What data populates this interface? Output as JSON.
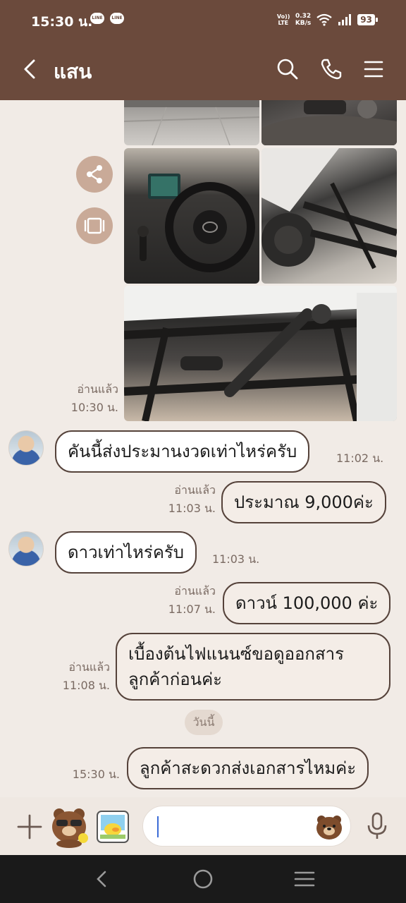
{
  "status_bar": {
    "time": "15:30 น.",
    "notif_badge": "LINE",
    "volte": "Vo)) LTE",
    "net_speed_value": "0.32",
    "net_speed_unit": "KB/s",
    "battery": "93"
  },
  "header": {
    "title": "แสน"
  },
  "photos_meta": {
    "read": "อ่านแล้ว",
    "time": "10:30 น."
  },
  "messages": [
    {
      "side": "other",
      "text": "คันนี้ส่งประมานงวดเท่าไหร่ครับ",
      "time": "11:02 น."
    },
    {
      "side": "mine",
      "read": "อ่านแล้ว",
      "time": "11:03 น.",
      "text": "ประมาณ 9,000ค่ะ"
    },
    {
      "side": "other",
      "text": "ดาวเท่าไหร่ครับ",
      "time": "11:03 น."
    },
    {
      "side": "mine",
      "read": "อ่านแล้ว",
      "time": "11:07 น.",
      "text": "ดาวน์ 100,000 ค่ะ"
    },
    {
      "side": "mine",
      "read": "อ่านแล้ว",
      "time": "11:08 น.",
      "line1": "เบื้องต้นไฟแนนซ์ขอดูออกสาร",
      "line2": "ลูกค้าก่อนค่ะ"
    },
    {
      "side": "mine",
      "time": "15:30 น.",
      "text": "ลูกค้าสะดวกส่งเอกสารไหมค่ะ"
    }
  ],
  "date_divider": "วันนี้",
  "input": {
    "placeholder": ""
  },
  "colors": {
    "header": "#6b4a3c",
    "chat_bg": "#f1ebe6",
    "bubble_border": "#55423a",
    "action_btn": "#c9aa98"
  },
  "icons": [
    "back-icon",
    "search-icon",
    "phone-icon",
    "menu-icon",
    "share-icon",
    "keep-icon",
    "plus-icon",
    "brown-sticker-icon",
    "sally-sticker-icon",
    "brown-emoji-icon",
    "mic-icon",
    "nav-back-icon",
    "nav-home-icon",
    "nav-recents-icon"
  ]
}
